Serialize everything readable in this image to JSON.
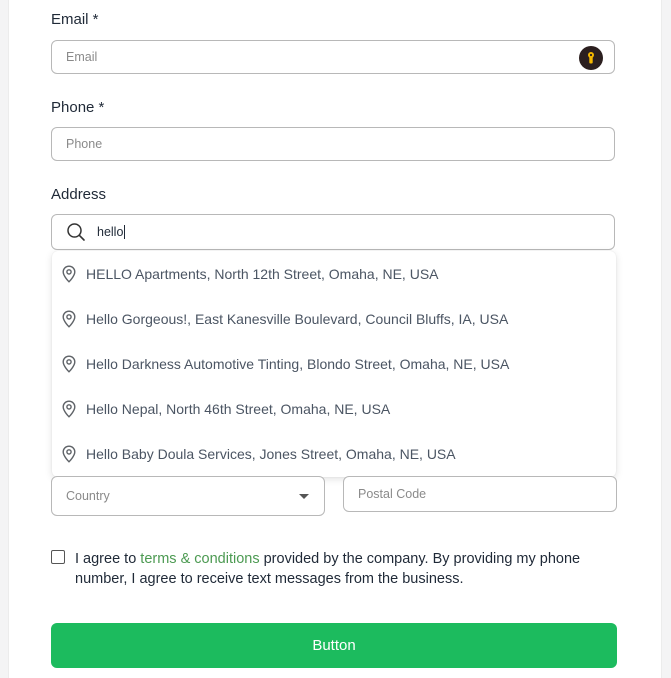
{
  "form": {
    "email": {
      "label": "Email *",
      "placeholder": "Email"
    },
    "phone": {
      "label": "Phone *",
      "placeholder": "Phone"
    },
    "address": {
      "label": "Address",
      "value": "hello",
      "suggestions": [
        "HELLO Apartments, North 12th Street, Omaha, NE, USA",
        "Hello Gorgeous!, East Kanesville Boulevard, Council Bluffs, IA, USA",
        "Hello Darkness Automotive Tinting, Blondo Street, Omaha, NE, USA",
        "Hello Nepal, North 46th Street, Omaha, NE, USA",
        "Hello Baby Doula Services, Jones Street, Omaha, NE, USA"
      ]
    },
    "country": {
      "placeholder": "Country"
    },
    "postal_code": {
      "placeholder": "Postal Code"
    },
    "consent": {
      "prefix": "I agree to ",
      "link": "terms & conditions",
      "suffix": " provided by the company. By providing my phone number, I agree to receive text messages from the business."
    },
    "submit_label": "Button"
  },
  "colors": {
    "accent": "#1cbb5e",
    "link": "#4c9a52",
    "key_icon_bg": "#2b1f1f",
    "key_icon_fg": "#f5b800"
  },
  "icons": [
    "password-manager-key-icon",
    "search-icon",
    "map-pin-icon",
    "chevron-down-icon"
  ]
}
